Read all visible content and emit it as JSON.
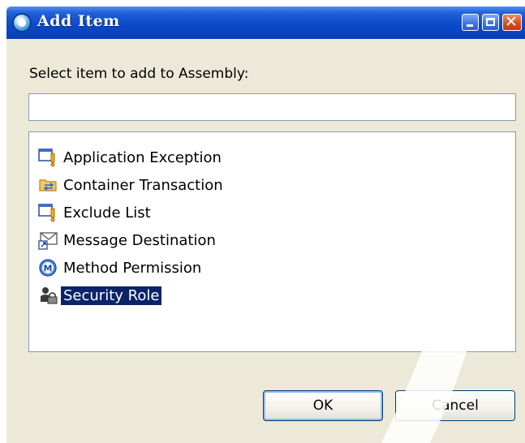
{
  "window": {
    "title": "Add Item"
  },
  "dialog": {
    "prompt": "Select item to add to Assembly:",
    "filter_value": "",
    "items": [
      {
        "label": "Application Exception",
        "icon": "exception-icon",
        "selected": false
      },
      {
        "label": "Container Transaction",
        "icon": "transaction-folder-icon",
        "selected": false
      },
      {
        "label": "Exclude List",
        "icon": "exclude-list-icon",
        "selected": false
      },
      {
        "label": "Message Destination",
        "icon": "message-destination-icon",
        "selected": false
      },
      {
        "label": "Method Permission",
        "icon": "method-permission-icon",
        "selected": false
      },
      {
        "label": "Security Role",
        "icon": "security-role-icon",
        "selected": true
      }
    ]
  },
  "buttons": {
    "ok": "OK",
    "cancel": "Cancel"
  },
  "colors": {
    "titlebar": "#0a49c8",
    "selection": "#0a246a",
    "dialog_bg": "#ece9d8"
  }
}
